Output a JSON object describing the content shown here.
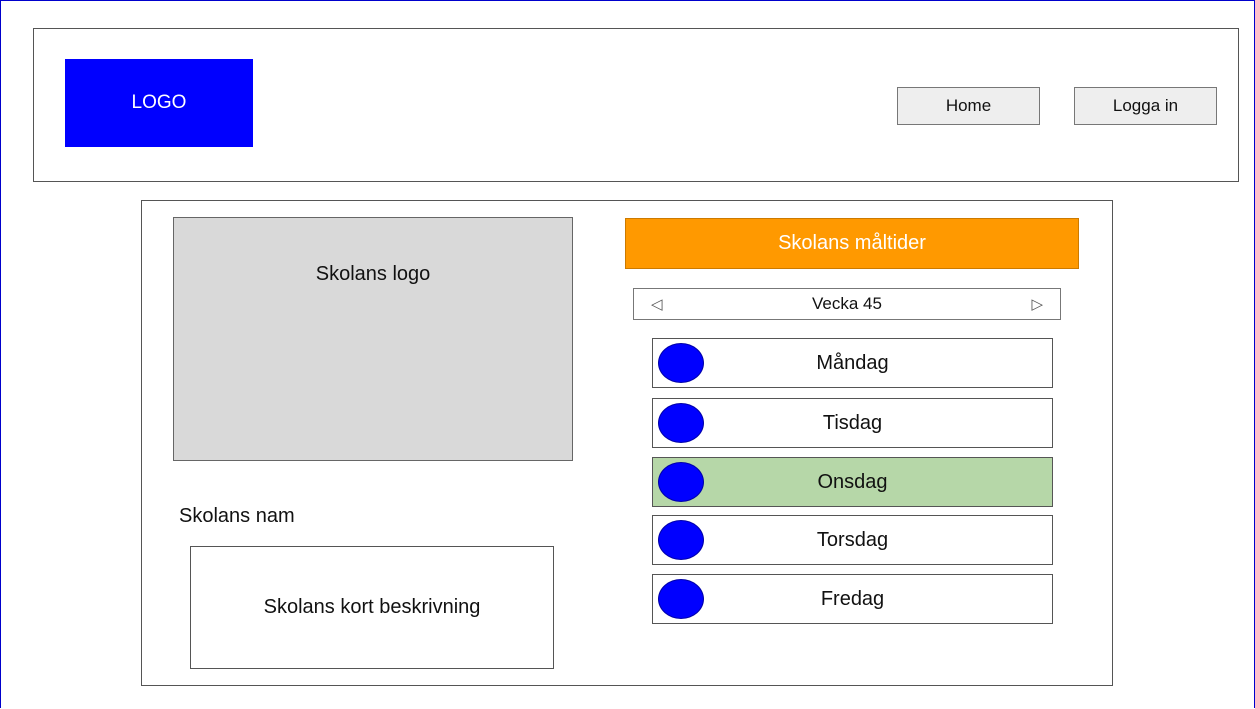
{
  "header": {
    "logo_text": "LOGO",
    "nav": {
      "home_label": "Home",
      "login_label": "Logga in"
    }
  },
  "school": {
    "logo_placeholder": "Skolans logo",
    "name": "Skolans nam",
    "description": "Skolans kort beskrivning"
  },
  "meals": {
    "title": "Skolans måltider",
    "week_label": "Vecka 45",
    "days": [
      {
        "label": "Måndag",
        "selected": false
      },
      {
        "label": "Tisdag",
        "selected": false
      },
      {
        "label": "Onsdag",
        "selected": true
      },
      {
        "label": "Torsdag",
        "selected": false
      },
      {
        "label": "Fredag",
        "selected": false
      }
    ]
  },
  "colors": {
    "logo_bg": "#0000ff",
    "meals_header_bg": "#ff9900",
    "selected_day_bg": "#b6d7a8",
    "day_dot": "#0000ff",
    "school_logo_bg": "#d9d9d9"
  },
  "icons": {
    "prev": "triangle-left-icon",
    "next": "triangle-right-icon",
    "day_marker": "circle-icon"
  }
}
